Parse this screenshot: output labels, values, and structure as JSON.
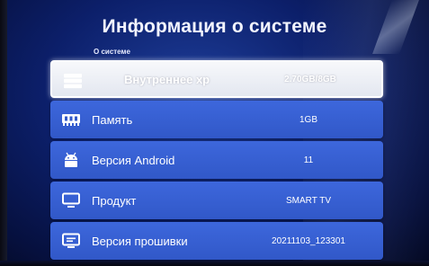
{
  "header": {
    "title": "Информация о системе"
  },
  "section": {
    "label": "О системе"
  },
  "rows": [
    {
      "label": "Внутреннее хр",
      "value": "2.70GB/8GB",
      "icon": "storage-icon",
      "selected": true
    },
    {
      "label": "Память",
      "value": "1GB",
      "icon": "memory-chip-icon",
      "selected": false
    },
    {
      "label": "Версия Android",
      "value": "11",
      "icon": "android-icon",
      "selected": false
    },
    {
      "label": "Продукт",
      "value": "SMART TV",
      "icon": "monitor-icon",
      "selected": false
    },
    {
      "label": "Версия прошивки",
      "value": "20211103_123301",
      "icon": "firmware-icon",
      "selected": false
    }
  ],
  "colors": {
    "row_bg": "#3158c8",
    "selected_bg": "#eef0f6",
    "background": "#0c1f6a",
    "text": "#ffffff"
  }
}
